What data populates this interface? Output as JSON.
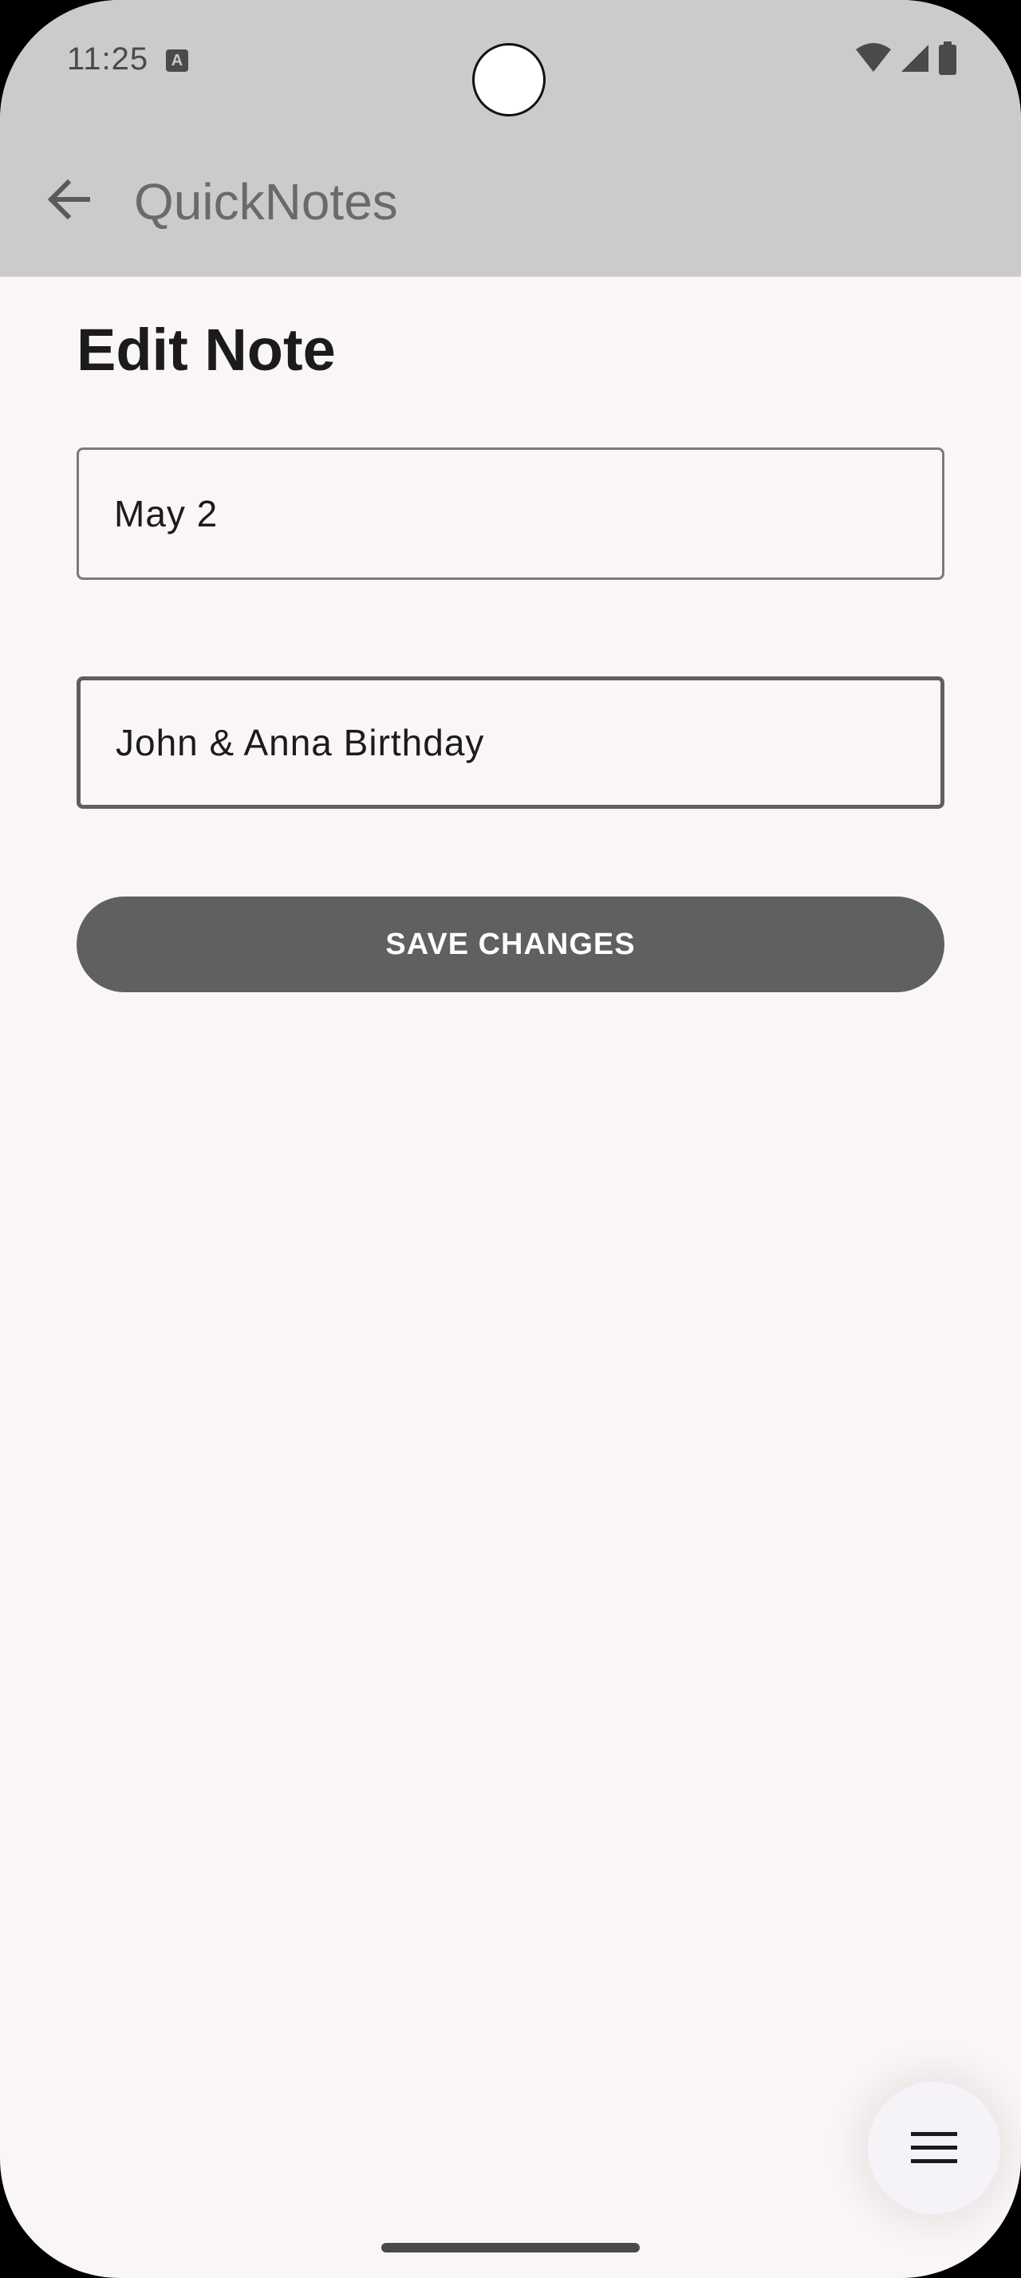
{
  "status_bar": {
    "time": "11:25",
    "notification_icon": "a-icon",
    "icons": [
      "wifi-icon",
      "signal-icon",
      "battery-icon"
    ]
  },
  "app_bar": {
    "back_icon": "arrow-back-icon",
    "title": "QuickNotes"
  },
  "main": {
    "page_title": "Edit Note",
    "date_field": {
      "value": "May 2"
    },
    "title_field": {
      "value": "John & Anna Birthday"
    },
    "save_label": "SAVE CHANGES"
  },
  "fab": {
    "icon": "menu-icon"
  },
  "colors": {
    "topbar": "#cbcbcb",
    "background": "#f9f6f5",
    "button": "#5f6062"
  }
}
